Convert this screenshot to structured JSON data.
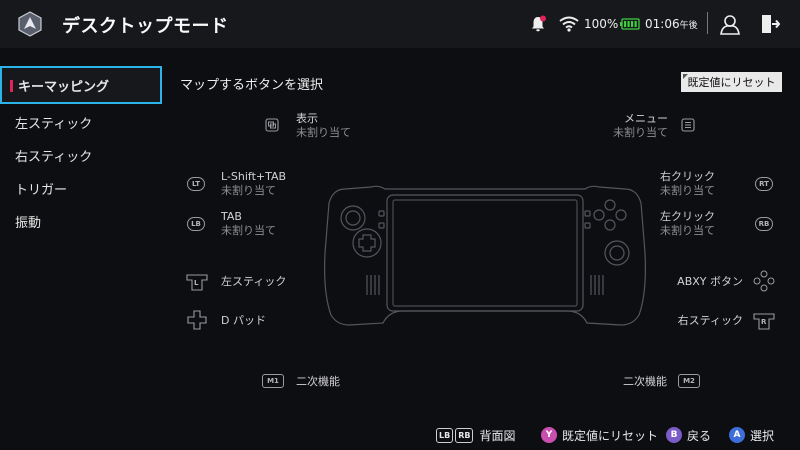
{
  "header": {
    "title": "デスクトップモード",
    "battery_percent": "100%",
    "time": "01:06",
    "time_suffix": "午後"
  },
  "sidebar": {
    "items": [
      {
        "label": "キーマッピング",
        "active": true
      },
      {
        "label": "左スティック"
      },
      {
        "label": "右スティック"
      },
      {
        "label": "トリガー"
      },
      {
        "label": "振動"
      }
    ]
  },
  "main": {
    "prompt": "マップするボタンを選択",
    "reset_label": "既定値にリセット",
    "view": {
      "label": "表示",
      "value": "未割り当て"
    },
    "menu": {
      "label": "メニュー",
      "value": "未割り当て"
    },
    "lt": {
      "label": "L-Shift+TAB",
      "value": "未割り当て"
    },
    "lb": {
      "label": "TAB",
      "value": "未割り当て"
    },
    "rt": {
      "label": "右クリック",
      "value": "未割り当て"
    },
    "rb": {
      "label": "左クリック",
      "value": "未割り当て"
    },
    "left_stick": {
      "label": "左スティック"
    },
    "dpad": {
      "label": "D パッド"
    },
    "abxy": {
      "label": "ABXY ボタン"
    },
    "right_stick": {
      "label": "右スティック"
    },
    "m1": {
      "label": "二次機能"
    },
    "m2": {
      "label": "二次機能"
    }
  },
  "badges": {
    "lt": "LT",
    "lb": "LB",
    "rt": "RT",
    "rb": "RB",
    "m1": "M1",
    "m2": "M2",
    "l": "L",
    "r": "R"
  },
  "footer": {
    "lb_key": "LB",
    "rb_key": "RB",
    "back_view": "背面図",
    "y_key": "Y",
    "reset": "既定値にリセット",
    "b_key": "B",
    "back": "戻る",
    "a_key": "A",
    "select": "選択"
  },
  "colors": {
    "accent": "#2ab4e8",
    "active_marker": "#e0245a",
    "notification_dot": "#e0245a",
    "battery": "#3ecf3e",
    "y_button": "#c84fb0",
    "b_button": "#7a5cc8",
    "a_button": "#3e6fd8"
  },
  "icons": [
    "app-logo-icon",
    "notification-bell-icon",
    "wifi-icon",
    "battery-icon",
    "user-icon",
    "exit-icon",
    "view-icon",
    "menu-icon",
    "dpad-icon",
    "abxy-icon"
  ]
}
